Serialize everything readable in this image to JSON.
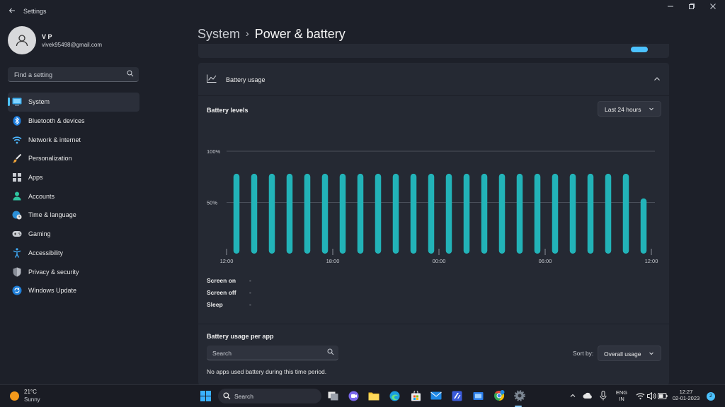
{
  "window": {
    "title": "Settings"
  },
  "profile": {
    "name": "V P",
    "email": "vivek95498@gmail.com"
  },
  "search": {
    "placeholder": "Find a setting"
  },
  "sidebar": {
    "items": [
      {
        "label": "System",
        "icon": "monitor-icon",
        "active": true
      },
      {
        "label": "Bluetooth & devices",
        "icon": "bluetooth-icon"
      },
      {
        "label": "Network & internet",
        "icon": "wifi-icon"
      },
      {
        "label": "Personalization",
        "icon": "brush-icon"
      },
      {
        "label": "Apps",
        "icon": "apps-icon"
      },
      {
        "label": "Accounts",
        "icon": "person-icon"
      },
      {
        "label": "Time & language",
        "icon": "globe-clock-icon"
      },
      {
        "label": "Gaming",
        "icon": "gamepad-icon"
      },
      {
        "label": "Accessibility",
        "icon": "accessibility-icon"
      },
      {
        "label": "Privacy & security",
        "icon": "shield-icon"
      },
      {
        "label": "Windows Update",
        "icon": "update-icon"
      }
    ]
  },
  "breadcrumb": {
    "root": "System",
    "separator": "›",
    "current": "Power & battery"
  },
  "battery_usage": {
    "title": "Battery usage",
    "levels_label": "Battery levels",
    "range": "Last 24 hours",
    "stats": [
      {
        "label": "Screen on",
        "value": "-"
      },
      {
        "label": "Screen off",
        "value": "-"
      },
      {
        "label": "Sleep",
        "value": "-"
      }
    ],
    "per_app_label": "Battery usage per app",
    "app_search_placeholder": "Search",
    "sort_label": "Sort by:",
    "sort_value": "Overall usage",
    "empty_message": "No apps used battery during this time period."
  },
  "chart_data": {
    "type": "bar",
    "y_ticks": [
      "100%",
      "50%"
    ],
    "x_ticks": [
      "12:00",
      "18:00",
      "00:00",
      "06:00",
      "12:00"
    ],
    "ylim": [
      0,
      100
    ],
    "values": [
      78,
      78,
      78,
      78,
      78,
      78,
      78,
      78,
      78,
      78,
      78,
      78,
      78,
      78,
      78,
      78,
      78,
      78,
      78,
      78,
      78,
      78,
      78,
      54
    ],
    "bar_color": "#22b3b8",
    "grid": true
  },
  "taskbar": {
    "weather": {
      "temp": "21°C",
      "condition": "Sunny"
    },
    "search_label": "Search",
    "language": {
      "line1": "ENG",
      "line2": "IN"
    },
    "clock": {
      "time": "12:27",
      "date": "02-01-2023"
    },
    "notifications": "2",
    "accent": "#4cc2ff"
  }
}
